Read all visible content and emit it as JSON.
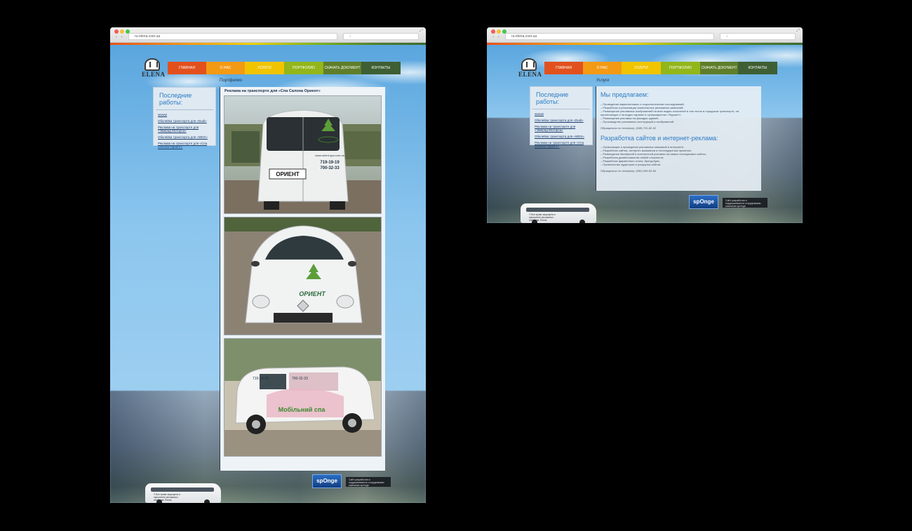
{
  "colors": {
    "menu": [
      "#e2511d",
      "#f39a14",
      "#f0c400",
      "#93b61a",
      "#5f7e2a",
      "#3e5f33"
    ],
    "accent": "#2c7cc4"
  },
  "left": {
    "url": "ru-elena.coer.ua",
    "logo": "ELENA",
    "menu": [
      "Главная",
      "О нас",
      "Услуги",
      "Портфолио",
      "Скачать документ",
      "Контакты"
    ],
    "breadcrumb": "Портфолио",
    "sidebar": {
      "title": "Последние работы:",
      "items": [
        "wwww",
        "Обклейка транспорта для «Dudi»",
        "Реклама на транспорте для «Эмерад Моторса»",
        "Обклейка транспорта для «WDS»",
        "Реклама на транспорте для «Спа Салона Ориент»"
      ]
    },
    "article_title": "Реклама на транспорте для «Спа Салона Ориент»",
    "photos": [
      {
        "plate": "ОРИЕНТ",
        "phone1": "719-19-19",
        "phone2": "700-32-33",
        "site": "www.orient-spa.com.ua"
      },
      {
        "brand": "ОРИЕНТ"
      },
      {
        "phone1": "719-19-19",
        "phone2": "700-32-33",
        "slogan": "Мобільний спа"
      }
    ],
    "footer": {
      "badge": "spOnge",
      "note": "Сайт разработан и поддерживается сотрудниками компании spOnge",
      "bus_copy": "© Все права защищены в приоритете рекламного агентства: Елена"
    }
  },
  "right": {
    "url": "ru-elena.coer.ua",
    "logo": "ELENA",
    "menu": [
      "Главная",
      "О нас",
      "Услуги",
      "Портфолио",
      "Скачать документ",
      "Контакты"
    ],
    "breadcrumb": "Услуги",
    "sidebar": {
      "title": "Последние работы:",
      "items": [
        "wwww",
        "Обклейка транспорта для «Dudi»",
        "Реклама на транспорте для «Эмерад Моторса»",
        "Обклейка транспорта для «WDS»",
        "Реклама на транспорте для «Спа Салона Ориент»"
      ]
    },
    "sections": [
      {
        "heading": "Мы предлагаем:",
        "lines": [
          "– Проведение маркетинговых и социологических исследований;",
          "– Разработка и реализация комплексных рекламных кампаний;",
          "– Размещение рекламных изображений на всех видах носителей в том числе в городском транспорте, на",
          "прилегающих и на видео экранах в супермаркетах «Фуршет»;",
          "– Размещение рекламы на фасадах зданий;",
          "– Производство рекламных конструкций и изображений."
        ],
        "phone": "Обращаться по телефону: (048) 701-82-52"
      },
      {
        "heading": "Разработка сайтов и интернет-реклама:",
        "lines": [
          "– Организация и проведение рекламных кампаний в интернете;",
          "– Разработка сайтов, интернет-магазинов и нестандартных проектов;",
          "– Размещение баннерной и контекстной рекламы на самых посещаемых сайтах;",
          "– Разработка дизайн-макетов любой сложности;",
          "– Разработка фирменного стиля, бренд-бука;",
          "– Привлечение аудитории и раскрутка сайтов."
        ],
        "phone": "Обращаться по телефону: (050) 909-52-84"
      }
    ],
    "footer": {
      "badge": "spOnge",
      "note": "Сайт разработан и поддерживается сотрудниками компании spOnge",
      "bus_copy": "© Все права защищены в приоритете рекламного агентства: Елена"
    }
  }
}
